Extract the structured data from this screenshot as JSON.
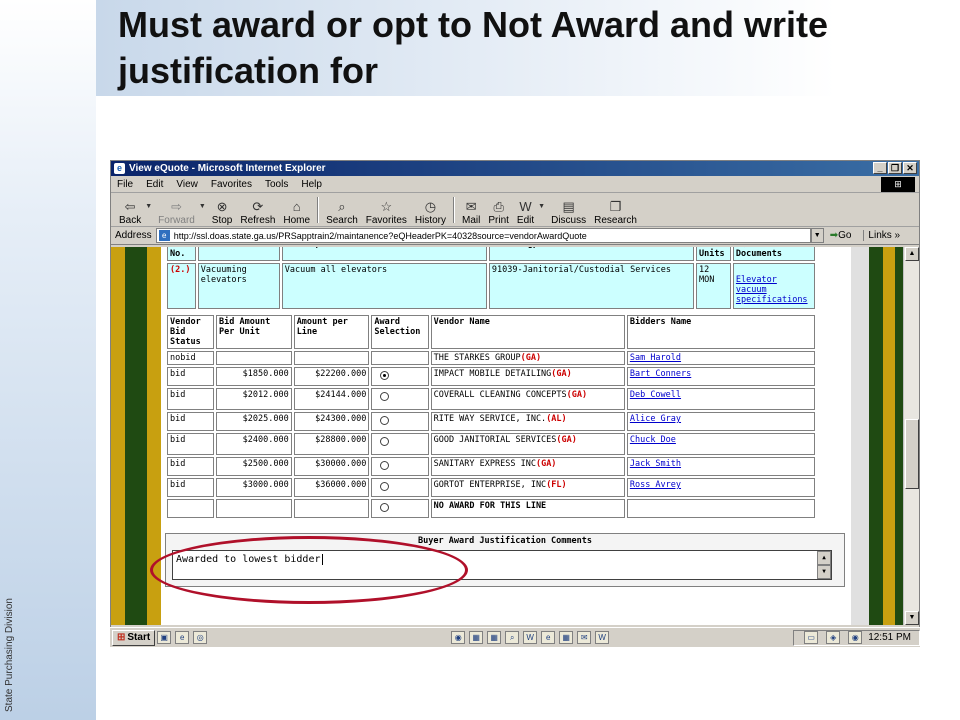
{
  "slide": {
    "title": "Must award or opt to Not Award and write justification for",
    "side_label": "State Purchasing Division"
  },
  "browser": {
    "title": "View eQuote - Microsoft Internet Explorer",
    "menu": [
      "File",
      "Edit",
      "View",
      "Favorites",
      "Tools",
      "Help"
    ],
    "toolbar": {
      "back": "Back",
      "forward": "Forward",
      "stop": "Stop",
      "refresh": "Refresh",
      "home": "Home",
      "search": "Search",
      "favorites": "Favorites",
      "history": "History",
      "mail": "Mail",
      "print": "Print",
      "edit": "Edit",
      "discuss": "Discuss",
      "research": "Research"
    },
    "address_label": "Address",
    "url": "http://ssl.doas.state.ga.us/PRSapptrain2/maintanence?eQHeaderPK=40328source=vendorAwardQuote",
    "go": "Go",
    "links": "Links"
  },
  "line_table": {
    "headers": [
      "Line No.",
      "Line Title",
      "Description",
      "Line Nigp",
      "No of Units",
      "eQuote Line Documents"
    ],
    "row": {
      "line_no": "(2.)",
      "title": "Vacuuming elevators",
      "description": "Vacuum all elevators",
      "nigp": "91039-Janitorial/Custodial Services",
      "units": "12 MON",
      "document": "Elevator vacuum specifications"
    }
  },
  "bid_table": {
    "headers": {
      "status": "Vendor Bid Status",
      "amount_unit": "Bid Amount Per Unit",
      "amount_line": "Amount per Line",
      "award": "Award Selection",
      "vendor": "Vendor Name",
      "bidder": "Bidders Name"
    },
    "rows": [
      {
        "status": "nobid",
        "unit": "",
        "line": "",
        "radio": false,
        "selected": false,
        "vendor": "THE STARKES GROUP",
        "state": "(GA)",
        "bidder": "Sam Harold"
      },
      {
        "status": "bid",
        "unit": "$1850.000",
        "line": "$22200.000",
        "radio": true,
        "selected": true,
        "vendor": "IMPACT MOBILE DETAILING",
        "state": "(GA)",
        "bidder": "Bart Conners"
      },
      {
        "status": "bid",
        "unit": "$2012.000",
        "line": "$24144.000",
        "radio": true,
        "selected": false,
        "vendor": "COVERALL CLEANING CONCEPTS",
        "state": "(GA)",
        "bidder": "Deb Cowell"
      },
      {
        "status": "bid",
        "unit": "$2025.000",
        "line": "$24300.000",
        "radio": true,
        "selected": false,
        "vendor": "RITE WAY SERVICE, INC.",
        "state": "(AL)",
        "bidder": "Alice Gray"
      },
      {
        "status": "bid",
        "unit": "$2400.000",
        "line": "$28800.000",
        "radio": true,
        "selected": false,
        "vendor": "GOOD JANITORIAL SERVICES",
        "state": "(GA)",
        "bidder": "Chuck Doe"
      },
      {
        "status": "bid",
        "unit": "$2500.000",
        "line": "$30000.000",
        "radio": true,
        "selected": false,
        "vendor": "SANITARY EXPRESS INC",
        "state": "(GA)",
        "bidder": "Jack Smith"
      },
      {
        "status": "bid",
        "unit": "$3000.000",
        "line": "$36000.000",
        "radio": true,
        "selected": false,
        "vendor": "GORTOT ENTERPRISE, INC",
        "state": "(FL)",
        "bidder": "Ross Avrey"
      },
      {
        "status": "",
        "unit": "",
        "line": "",
        "radio": true,
        "selected": false,
        "vendor": "NO AWARD FOR THIS LINE",
        "state": "",
        "bidder": ""
      }
    ]
  },
  "justification": {
    "title": "Buyer Award Justification Comments",
    "text": "Awarded to lowest bidder"
  },
  "taskbar": {
    "start": "Start",
    "clock": "12:51 PM"
  },
  "colors": {
    "accent_oval": "#b0102a",
    "stripe_green": "#1f4a12",
    "stripe_gold": "#c8a010",
    "cell_cyan": "#ccffff"
  }
}
